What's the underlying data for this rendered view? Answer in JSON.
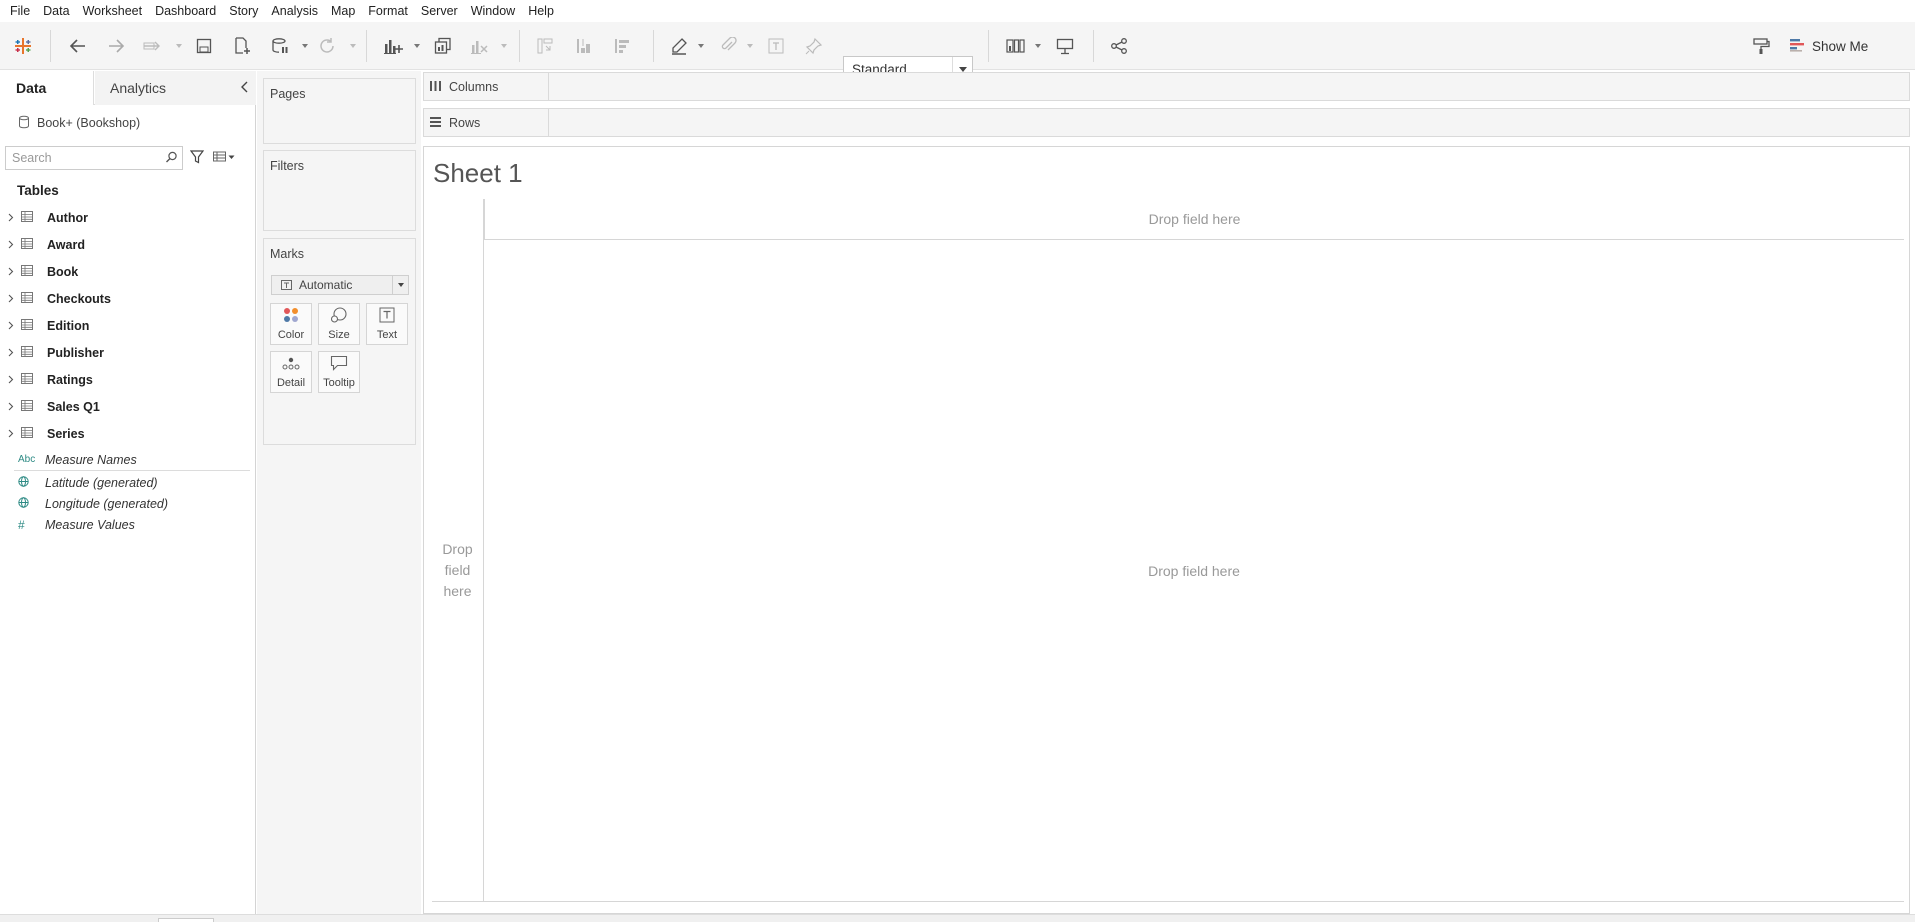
{
  "menu": [
    "File",
    "Data",
    "Worksheet",
    "Dashboard",
    "Story",
    "Analysis",
    "Map",
    "Format",
    "Server",
    "Window",
    "Help"
  ],
  "toolbar": {
    "fit_value": "Standard",
    "show_me_label": "Show Me",
    "icons": [
      "tableau-logo-icon",
      "undo-icon",
      "redo-icon",
      "new-data-source-icon",
      "save-icon",
      "add-data-source-icon",
      "pause-updates-icon",
      "refresh-icon",
      "new-worksheet-icon",
      "duplicate-sheet-icon",
      "clear-sheet-icon",
      "swap-rows-columns-icon",
      "sort-ascending-icon",
      "sort-descending-icon",
      "highlight-icon",
      "group-icon",
      "show-labels-icon",
      "fix-axes-icon",
      "show-cards-icon",
      "presentation-mode-icon",
      "share-icon",
      "format-painter-icon",
      "show-me-icon"
    ]
  },
  "data_pane": {
    "tabs": [
      "Data",
      "Analytics"
    ],
    "source": "Book+ (Bookshop)",
    "search_placeholder": "Search",
    "tables_heading": "Tables",
    "tables": [
      "Author",
      "Award",
      "Book",
      "Checkouts",
      "Edition",
      "Publisher",
      "Ratings",
      "Sales Q1",
      "Series"
    ],
    "fields": [
      {
        "type": "Abc",
        "name": "Measure Names"
      },
      {
        "type": "globe",
        "name": "Latitude (generated)"
      },
      {
        "type": "globe",
        "name": "Longitude (generated)"
      },
      {
        "type": "#",
        "name": "Measure Values"
      }
    ]
  },
  "cards": {
    "pages": "Pages",
    "filters": "Filters",
    "marks": "Marks",
    "mark_type": "Automatic",
    "mark_buttons": [
      "Color",
      "Size",
      "Text",
      "Detail",
      "Tooltip"
    ]
  },
  "shelves": {
    "columns": "Columns",
    "rows": "Rows"
  },
  "view": {
    "sheet_title": "Sheet 1",
    "drop_columns": "Drop field here",
    "drop_rows": "Drop field here",
    "drop_center": "Drop field here"
  },
  "colors": {
    "accent_teal": "#2d8a84",
    "logo_orange": "#e8762d",
    "logo_blue": "#1f77b4"
  }
}
